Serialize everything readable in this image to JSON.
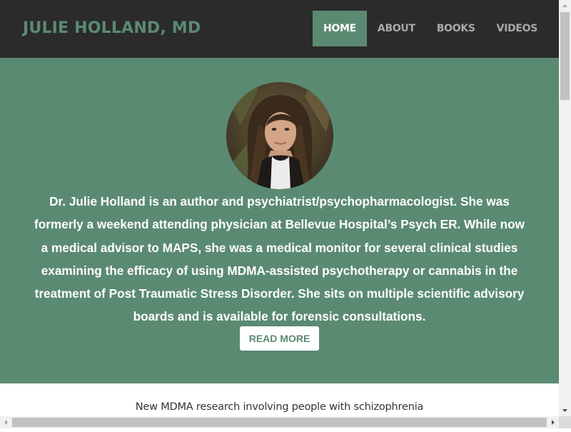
{
  "header": {
    "brand": "JULIE HOLLAND, MD",
    "nav": [
      {
        "label": "HOME",
        "active": true
      },
      {
        "label": "ABOUT",
        "active": false
      },
      {
        "label": "BOOKS",
        "active": false
      },
      {
        "label": "VIDEOS",
        "active": false
      }
    ]
  },
  "hero": {
    "bio_lines": [
      "Dr. Julie Holland is an author and psychiatrist/psychopharmacologist. She was",
      "formerly a weekend attending physician at Bellevue Hospital’s Psych ER. While now",
      "a medical advisor to MAPS, she was a medical monitor for several clinical studies",
      "examining the efficacy of using MDMA-assisted psychotherapy or cannabis in the",
      "treatment of Post Traumatic Stress Disorder. She sits on multiple scientific advisory",
      "boards and is available for forensic consultations."
    ],
    "read_more_label": "READ MORE"
  },
  "content": {
    "headline": "New MDMA research involving people with schizophrenia"
  },
  "colors": {
    "accent": "#5b8a72",
    "header_bg": "#2b2b2b",
    "nav_text": "#a9a9a9"
  }
}
